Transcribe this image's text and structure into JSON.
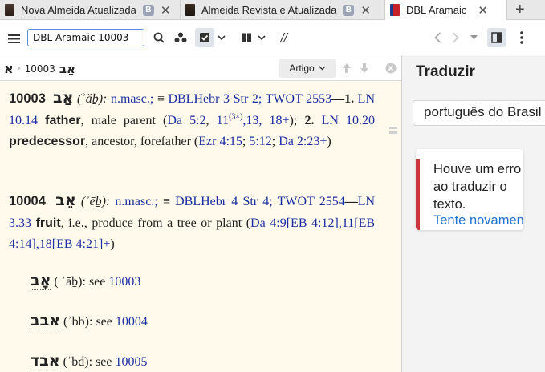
{
  "tabs": [
    {
      "title": "Nova Almeida Atualizada",
      "badge": "B",
      "active": false
    },
    {
      "title": "Almeida Revista e Atualizada",
      "badge": "B",
      "active": false
    },
    {
      "title": "DBL Aramaic",
      "active": true
    }
  ],
  "toolbar": {
    "search_value": "DBL Aramaic 10003",
    "slash_label": "//"
  },
  "nav": {
    "headword": "א",
    "crumb_number": "10003",
    "crumb_word": "אַב",
    "view_label": "Artigo"
  },
  "entries": [
    {
      "number": "10003",
      "hebrew": "אַב",
      "translit": "(ʾǎḇ):",
      "pos": "n.masc.;",
      "equiv": "≡",
      "dbl": "DBLHebr 3",
      "str": "Str 2;",
      "twot": "TWOT 2553",
      "sense1_num": "1.",
      "sense1_ln": "LN 10.14",
      "sense1_gloss": "father",
      "sense1_desc": ", male parent (",
      "sense1_ref1": "Da 5:2",
      "sense1_sep1": ", ",
      "sense1_ref2": "11",
      "sense1_sup": "(3×)",
      "sense1_ref3": ",13,",
      "sense1_ref4": "18+",
      "sense1_close": "); ",
      "sense2_num": "2.",
      "sense2_ln": "LN 10.20",
      "sense2_gloss": "predecessor",
      "sense2_desc": ", ancestor, forefather (",
      "sense2_ref1": "Ezr 4:15",
      "sense2_sep": "; ",
      "sense2_ref2": "5:12",
      "sense2_sep2": "; ",
      "sense2_ref3": "Da 2:23+",
      "sense2_close": ")"
    },
    {
      "number": "10004",
      "hebrew": "אֵב",
      "translit": "(ʾēḇ):",
      "pos": "n.masc.;",
      "equiv": "≡",
      "dbl": "DBLHebr 4",
      "str": "Str 4;",
      "twot": "TWOT 2554",
      "ln": "LN 3.33",
      "gloss": "fruit",
      "desc": ", i.e., produce from a tree or plant (",
      "ref1": "Da 4:9",
      "ref1b": "[EB 4:12]",
      "ref2": ",11",
      "ref2b": "[EB 4:14]",
      "ref3": ",18",
      "ref3b": "[EB 4:21]",
      "ref_end": "+",
      "close": ")"
    }
  ],
  "see_also": [
    {
      "hebrew": "אָב",
      "translit": "( ʾāḇ): see",
      "target": "10003"
    },
    {
      "hebrew": "אבב",
      "translit": "(ʾbb): see",
      "target": "10004"
    },
    {
      "hebrew": "אבד",
      "translit": "(ʾbd): see",
      "target": "10005"
    }
  ],
  "translate_panel": {
    "title": "Traduzir",
    "language": "português do Brasil",
    "error_message": "Houve um erro ao traduzir o texto.",
    "retry_label": "Tente novamente"
  },
  "colors": {
    "link": "#1a2ea0",
    "content_bg": "#fffaeb",
    "error_bar": "#c9363e",
    "retry": "#1f6fcf"
  }
}
